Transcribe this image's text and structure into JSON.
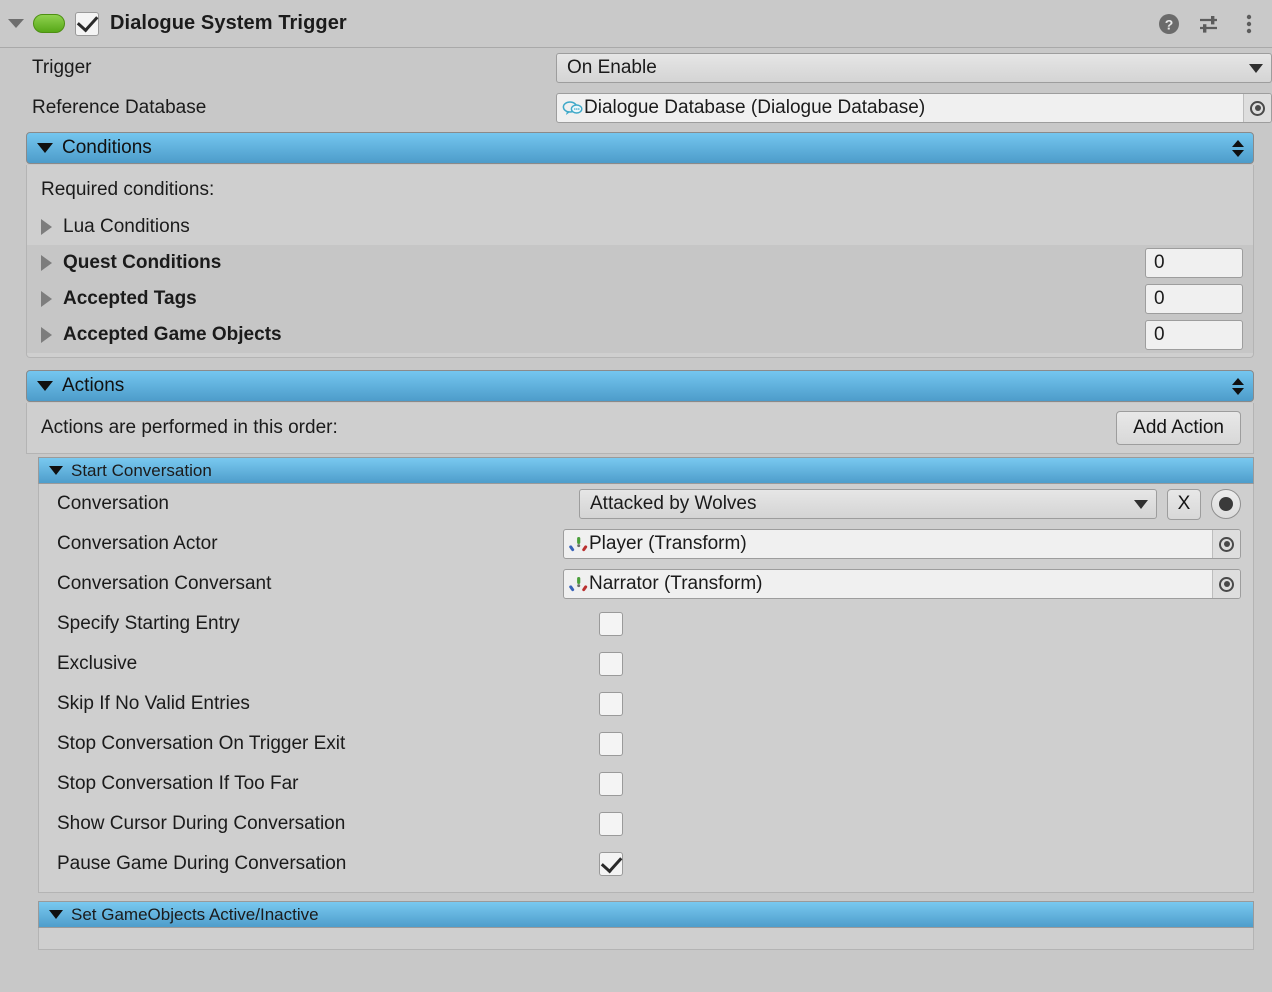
{
  "component": {
    "title": "Dialogue System Trigger",
    "enabled": true,
    "expanded": true,
    "icons": {
      "foldout": "chevron-down-icon",
      "script": "script-capsule-icon",
      "help": "help-icon",
      "preset": "preset-sliders-icon",
      "menu": "three-dot-menu-icon"
    }
  },
  "fields": {
    "trigger": {
      "label": "Trigger",
      "value": "On Enable"
    },
    "reference_database": {
      "label": "Reference Database",
      "value": "Dialogue Database (Dialogue Database)",
      "icon": "dialogue-database-icon"
    }
  },
  "conditions": {
    "header": "Conditions",
    "expanded": true,
    "intro": "Required conditions:",
    "items": [
      {
        "label": "Lua Conditions",
        "bold": false,
        "count": null,
        "expanded": false
      },
      {
        "label": "Quest Conditions",
        "bold": true,
        "count": "0",
        "expanded": false
      },
      {
        "label": "Accepted Tags",
        "bold": true,
        "count": "0",
        "expanded": false
      },
      {
        "label": "Accepted Game Objects",
        "bold": true,
        "count": "0",
        "expanded": false
      }
    ]
  },
  "actions": {
    "header": "Actions",
    "expanded": true,
    "intro": "Actions are performed in this order:",
    "add_button": "Add Action",
    "start_conversation": {
      "header": "Start Conversation",
      "expanded": true,
      "conversation": {
        "label": "Conversation",
        "value": "Attacked by Wolves",
        "clear_button": "X"
      },
      "conversation_actor": {
        "label": "Conversation Actor",
        "value": "Player (Transform)"
      },
      "conversation_conversant": {
        "label": "Conversation Conversant",
        "value": "Narrator (Transform)"
      },
      "toggles": [
        {
          "label": "Specify Starting Entry",
          "checked": false
        },
        {
          "label": "Exclusive",
          "checked": false
        },
        {
          "label": "Skip If No Valid Entries",
          "checked": false
        },
        {
          "label": "Stop Conversation On Trigger Exit",
          "checked": false
        },
        {
          "label": "Stop Conversation If Too Far",
          "checked": false
        },
        {
          "label": "Show Cursor During Conversation",
          "checked": false
        },
        {
          "label": "Pause Game During Conversation",
          "checked": true
        }
      ]
    },
    "set_gameobjects": {
      "header": "Set GameObjects Active/Inactive",
      "expanded": true
    }
  },
  "colors": {
    "background": "#c8c8c8",
    "panel": "#cfcfcf",
    "section_blue_top": "#74c6ef",
    "section_blue_bottom": "#4d9cca",
    "field_background": "#f0f0f0",
    "script_green": "#57a818"
  }
}
